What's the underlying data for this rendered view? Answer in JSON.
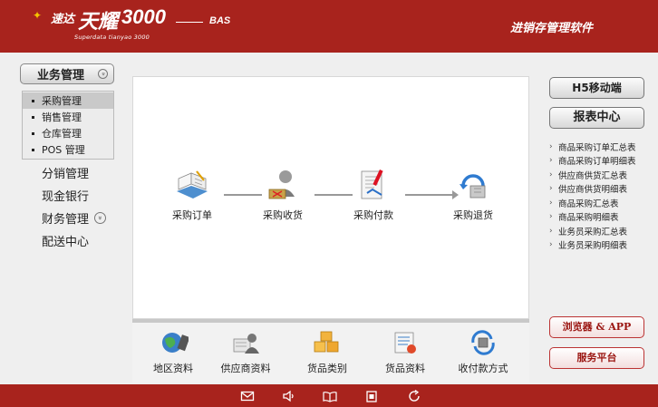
{
  "header": {
    "logo_brand": "速达",
    "logo_name": "天耀",
    "logo_number": "3000",
    "logo_subtitle": "Superdata tianyao 3000",
    "logo_edition": "BAS",
    "title": "进销存管理软件"
  },
  "sidebar": {
    "section": "业务管理",
    "section_chevron": "»",
    "submenu": [
      {
        "label": "采购管理",
        "active": true
      },
      {
        "label": "销售管理",
        "active": false
      },
      {
        "label": "仓库管理",
        "active": false
      },
      {
        "label": "POS 管理",
        "active": false
      }
    ],
    "items": [
      "分销管理",
      "现金银行",
      "财务管理",
      "配送中心"
    ],
    "finance_chevron": "»"
  },
  "flow": [
    {
      "label": "采购订单",
      "icon": "purchase-order-icon"
    },
    {
      "label": "采购收货",
      "icon": "purchase-receipt-icon"
    },
    {
      "label": "采购付款",
      "icon": "purchase-payment-icon"
    },
    {
      "label": "采购退货",
      "icon": "purchase-return-icon"
    }
  ],
  "base_data": [
    {
      "label": "地区资料",
      "icon": "globe-icon"
    },
    {
      "label": "供应商资料",
      "icon": "supplier-icon"
    },
    {
      "label": "货品类别",
      "icon": "boxes-icon"
    },
    {
      "label": "货品资料",
      "icon": "goods-icon"
    },
    {
      "label": "收付款方式",
      "icon": "payment-method-icon"
    }
  ],
  "right": {
    "mobile_button": "H5移动端",
    "report_button": "报表中心",
    "reports": [
      "商品采购订单汇总表",
      "商品采购订单明细表",
      "供应商供货汇总表",
      "供应商供货明细表",
      "商品采购汇总表",
      "商品采购明细表",
      "业务员采购汇总表",
      "业务员采购明细表"
    ],
    "browser_app_button": "浏览器 & APP",
    "service_button": "服务平台"
  },
  "footer_icons": [
    "mail-icon",
    "speaker-icon",
    "book-icon",
    "document-icon",
    "refresh-icon"
  ],
  "colors": {
    "brand_red": "#a8231d",
    "accent_gold": "#f5c400"
  }
}
